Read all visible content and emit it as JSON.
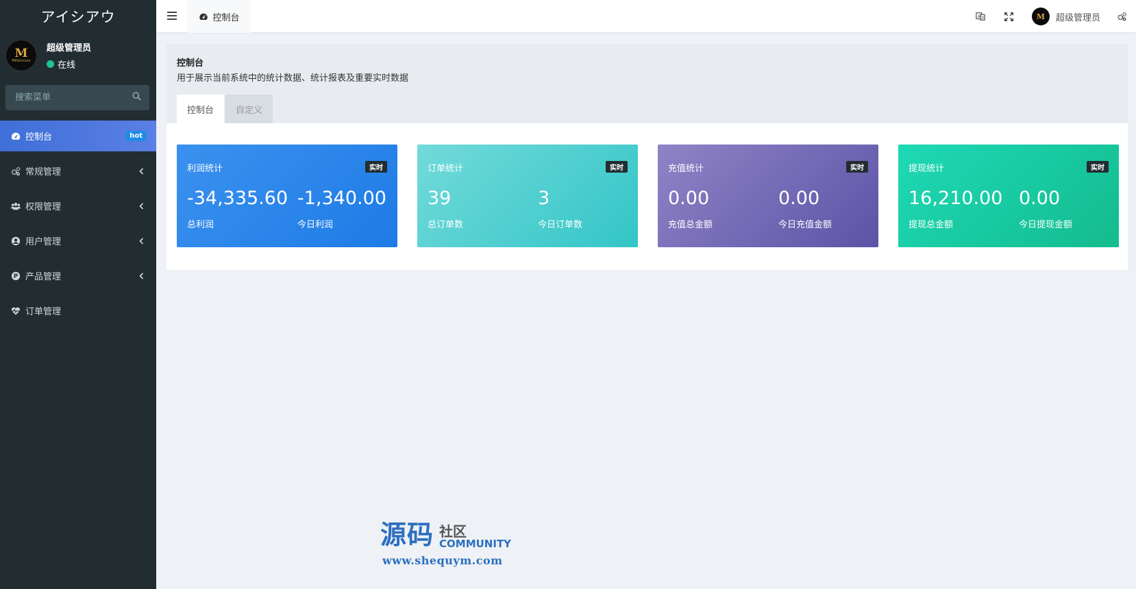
{
  "app": {
    "logo": "アイシアウ"
  },
  "sidebar": {
    "user": {
      "name": "超级管理员",
      "status": "在线",
      "avatar_text": "M",
      "avatar_sub": "Millennium"
    },
    "search": {
      "placeholder": "搜索菜单"
    },
    "items": [
      {
        "label": "控制台",
        "icon": "dashboard-icon",
        "badge": "hot",
        "active": true
      },
      {
        "label": "常规管理",
        "icon": "cogs-icon"
      },
      {
        "label": "权限管理",
        "icon": "group-icon"
      },
      {
        "label": "用户管理",
        "icon": "user-circle-icon"
      },
      {
        "label": "产品管理",
        "icon": "product-p-icon"
      },
      {
        "label": "订单管理",
        "icon": "heartbeat-icon"
      }
    ]
  },
  "topbar": {
    "tab_label": "控制台",
    "user_name": "超级管理员",
    "user_avatar_text": "M"
  },
  "panel": {
    "title": "控制台",
    "description": "用于展示当前系统中的统计数据、统计报表及重要实时数据",
    "tabs": [
      {
        "label": "控制台"
      },
      {
        "label": "自定义"
      }
    ]
  },
  "cards": [
    {
      "title": "利润统计",
      "tag": "实时",
      "value1": "-34,335.60",
      "label1": "总利润",
      "value2": "-1,340.00",
      "label2": "今日利润"
    },
    {
      "title": "订单统计",
      "tag": "实时",
      "value1": "39",
      "label1": "总订单数",
      "value2": "3",
      "label2": "今日订单数"
    },
    {
      "title": "充值统计",
      "tag": "实时",
      "value1": "0.00",
      "label1": "充值总金额",
      "value2": "0.00",
      "label2": "今日充值金额"
    },
    {
      "title": "提现统计",
      "tag": "实时",
      "value1": "16,210.00",
      "label1": "提现总金额",
      "value2": "0.00",
      "label2": "今日提现金额"
    }
  ],
  "watermark": {
    "main": "源码",
    "side_top": "社区",
    "side_bottom": "COMMUNITY",
    "url": "www.shequym.com"
  },
  "colors": {
    "sidebar_bg": "#222d32",
    "active_menu": "#4c7de6",
    "card_blue": "#1e7be6",
    "card_teal": "#33c5c7",
    "card_purple": "#5c53a6",
    "card_green": "#14bb8e"
  }
}
